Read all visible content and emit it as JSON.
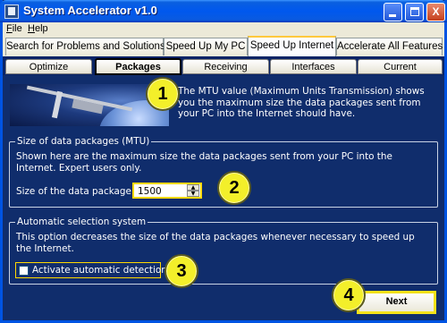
{
  "window": {
    "title": "System Accelerator v1.0",
    "minimize_label": "",
    "maximize_label": "",
    "close_label": "X"
  },
  "menu": {
    "file": "File",
    "help": "Help"
  },
  "main_tabs": [
    {
      "label": "Search for Problems and Solutions"
    },
    {
      "label": "Speed Up My PC"
    },
    {
      "label": "Speed Up Internet"
    },
    {
      "label": "Accelerate All Features"
    }
  ],
  "main_tabs_active": "Speed Up Internet",
  "sub_tabs": [
    {
      "label": "Optimize"
    },
    {
      "label": "Packages"
    },
    {
      "label": "Receiving"
    },
    {
      "label": "Interfaces"
    },
    {
      "label": "Current"
    }
  ],
  "sub_tabs_active": "Packages",
  "intro": {
    "text": "The MTU value (Maximum Units Transmission) shows you the maximum size the data packages sent from your PC into the Internet should have."
  },
  "mtu_group": {
    "legend": "Size of data packages (MTU)",
    "description": "Shown here are the maximum size the data packages sent from your PC into the Internet. Expert users only.",
    "field_label": "Size of the data package:",
    "field_value": "1500"
  },
  "auto_group": {
    "legend": "Automatic selection system",
    "description": "This option decreases the size of the data packages whenever necessary to speed up the Internet.",
    "checkbox_label": "Activate automatic detection",
    "checkbox_checked": false
  },
  "next_button": "Next",
  "callouts": [
    "1",
    "2",
    "3",
    "4"
  ],
  "colors": {
    "titlebar": "#0058ee",
    "panel_bg": "#102d6c",
    "highlight": "#ffd800",
    "callout": "#f3ef2a"
  },
  "icons": {
    "app": "app-icon",
    "minimize": "minimize-icon",
    "maximize": "maximize-icon",
    "close": "close-icon",
    "spin_up": "spin-up-icon",
    "spin_down": "spin-down-icon"
  }
}
